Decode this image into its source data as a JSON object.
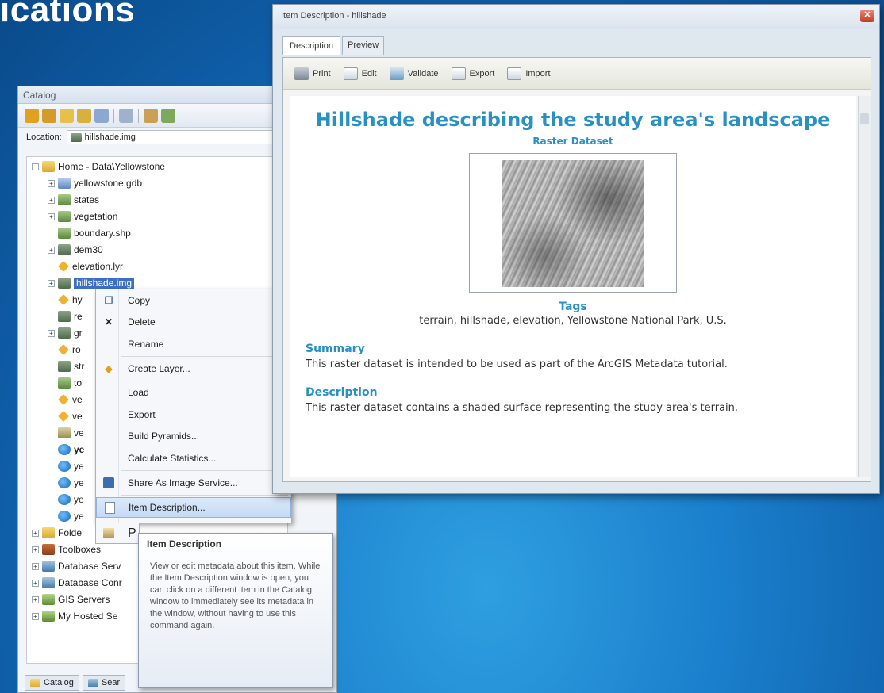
{
  "slide": {
    "title": "ications"
  },
  "catalog": {
    "title": "Catalog",
    "location_label": "Location:",
    "location_value": "hillshade.img",
    "tree": [
      {
        "label": "Home - Data\\Yellowstone",
        "icon": "folder-icon"
      },
      {
        "label": "yellowstone.gdb",
        "icon": "geodatabase-icon"
      },
      {
        "label": "states",
        "icon": "shapefile-icon"
      },
      {
        "label": "vegetation",
        "icon": "shapefile-icon"
      },
      {
        "label": "boundary.shp",
        "icon": "shapefile-icon"
      },
      {
        "label": "dem30",
        "icon": "raster-icon"
      },
      {
        "label": "elevation.lyr",
        "icon": "layer-icon"
      },
      {
        "label": "hillshade.img",
        "icon": "raster-icon"
      },
      {
        "label": "hy",
        "icon": "layer-icon"
      },
      {
        "label": "re",
        "icon": "raster-icon"
      },
      {
        "label": "gr",
        "icon": "raster-icon"
      },
      {
        "label": "ro",
        "icon": "layer-icon"
      },
      {
        "label": "str",
        "icon": "raster-icon"
      },
      {
        "label": "to",
        "icon": "checkbox-icon"
      },
      {
        "label": "ve",
        "icon": "layer-icon"
      },
      {
        "label": "ve",
        "icon": "layer-icon"
      },
      {
        "label": "ve",
        "icon": "raster-icon"
      },
      {
        "label": "ye",
        "icon": "globe-icon"
      },
      {
        "label": "ye",
        "icon": "globe-icon"
      },
      {
        "label": "ye",
        "icon": "globe-icon"
      },
      {
        "label": "ye",
        "icon": "globe-icon"
      },
      {
        "label": "ye",
        "icon": "globe-icon"
      },
      {
        "label": "Folde",
        "icon": "folder-icon"
      },
      {
        "label": "Toolboxes",
        "icon": "toolbox-icon"
      },
      {
        "label": "Database Serv",
        "icon": "database-icon"
      },
      {
        "label": "Database Conr",
        "icon": "database-icon"
      },
      {
        "label": "GIS Servers",
        "icon": "server-icon"
      },
      {
        "label": "My Hosted Se",
        "icon": "server-icon"
      }
    ],
    "tabs": [
      {
        "label": "Catalog"
      },
      {
        "label": "Sear"
      }
    ]
  },
  "context_menu": {
    "items": [
      {
        "label": "Copy",
        "icon": "copy-icon"
      },
      {
        "label": "Delete",
        "icon": "delete-icon"
      },
      {
        "label": "Rename",
        "icon": ""
      },
      {
        "label": "Create Layer...",
        "icon": "layer-icon"
      },
      {
        "label": "Load",
        "icon": ""
      },
      {
        "label": "Export",
        "icon": ""
      },
      {
        "label": "Build Pyramids...",
        "icon": ""
      },
      {
        "label": "Calculate Statistics...",
        "icon": ""
      },
      {
        "label": "Share As Image Service...",
        "icon": "image-service-icon"
      },
      {
        "label": "Item Description...",
        "icon": "item-description-icon"
      },
      {
        "label": "P",
        "icon": "properties-icon"
      }
    ]
  },
  "tooltip": {
    "title": "Item Description",
    "body": "View or edit metadata about this item. While the Item Description window is open, you can click on a different item in the Catalog window to immediately see its metadata in the window, without having to use this command again."
  },
  "item_window": {
    "title": "Item Description - hillshade",
    "close": "✕",
    "tabs": [
      {
        "label": "Description"
      },
      {
        "label": "Preview"
      }
    ],
    "toolbar": [
      {
        "label": "Print",
        "icon": "print-icon"
      },
      {
        "label": "Edit",
        "icon": "edit-icon"
      },
      {
        "label": "Validate",
        "icon": "validate-icon"
      },
      {
        "label": "Export",
        "icon": "export-icon"
      },
      {
        "label": "Import",
        "icon": "import-icon"
      }
    ],
    "doc": {
      "title": "Hillshade describing the study area's landscape",
      "type": "Raster Dataset",
      "tags_heading": "Tags",
      "tags": "terrain, hillshade, elevation, Yellowstone National Park, U.S.",
      "summary_heading": "Summary",
      "summary": "This raster dataset is intended to be used as part of the ArcGIS Metadata tutorial.",
      "description_heading": "Description",
      "description": "This raster dataset contains a shaded surface representing the study area's terrain."
    }
  }
}
